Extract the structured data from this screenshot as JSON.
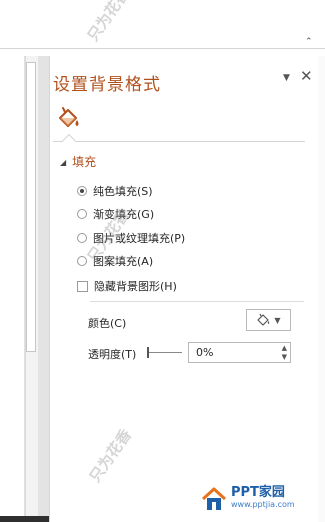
{
  "pane": {
    "title": "设置背景格式",
    "close_glyph": "✕",
    "dropdown_glyph": "▼"
  },
  "fill_section": {
    "header": "填充",
    "options": [
      {
        "label": "纯色填充(S)",
        "selected": true
      },
      {
        "label": "渐变填充(G)",
        "selected": false
      },
      {
        "label": "图片或纹理填充(P)",
        "selected": false
      },
      {
        "label": "图案填充(A)",
        "selected": false
      }
    ],
    "hide_background_graphics": {
      "label": "隐藏背景图形(H)",
      "checked": false
    },
    "color_label": "颜色(C)",
    "transparency_label": "透明度(T)",
    "transparency_value": "0%"
  },
  "watermark": {
    "text": "只为花香",
    "logo_main": "PPT家园",
    "logo_sub": "www.pptjia.com"
  },
  "colors": {
    "accent": "#b2501c",
    "logo_blue": "#1e5fa8",
    "logo_orange": "#e8731c"
  },
  "icons": {
    "fill_tab": "paint-bucket-icon",
    "color_button": "paint-bucket-icon"
  }
}
